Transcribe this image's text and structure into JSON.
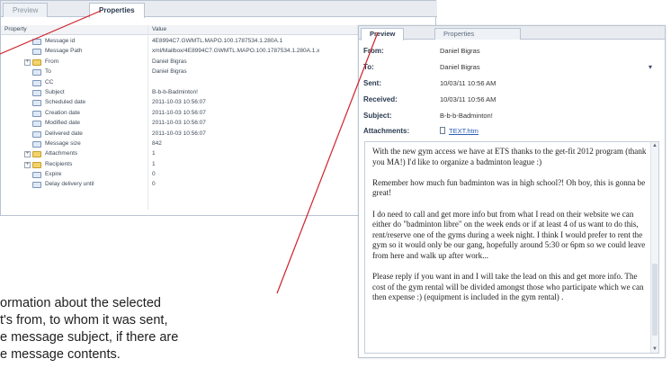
{
  "properties_panel": {
    "tabs": [
      {
        "label": "Preview",
        "active": false
      },
      {
        "label": "Properties",
        "active": true
      }
    ],
    "column_headers": {
      "property": "Property",
      "value": "Value"
    },
    "rows": [
      {
        "name": "Message id",
        "value": "4E8994C7.GWMTL.MAPO.100.1787534.1.280A.1",
        "type": "item",
        "expandable": false
      },
      {
        "name": "Message Path",
        "value": "xml/Mailbox/4E8994C7.GWMTL.MAPO.100.1787534.1.280A.1.x",
        "type": "item",
        "expandable": false
      },
      {
        "name": "From",
        "value": "Daniel Bigras",
        "type": "folder",
        "expandable": true
      },
      {
        "name": "To",
        "value": "Daniel Bigras",
        "type": "item",
        "expandable": false
      },
      {
        "name": "CC",
        "value": "",
        "type": "item",
        "expandable": false
      },
      {
        "name": "Subject",
        "value": "B-b-b-Badminton!",
        "type": "item",
        "expandable": false
      },
      {
        "name": "Scheduled date",
        "value": "2011-10-03 10:56:07",
        "type": "item",
        "expandable": false
      },
      {
        "name": "Creation date",
        "value": "2011-10-03 10:56:07",
        "type": "item",
        "expandable": false
      },
      {
        "name": "Modified date",
        "value": "2011-10-03 10:56:07",
        "type": "item",
        "expandable": false
      },
      {
        "name": "Delivered date",
        "value": "2011-10-03 10:56:07",
        "type": "item",
        "expandable": false
      },
      {
        "name": "Message size",
        "value": "842",
        "type": "item",
        "expandable": false
      },
      {
        "name": "Attachments",
        "value": "1",
        "type": "folder",
        "expandable": true
      },
      {
        "name": "Recipients",
        "value": "1",
        "type": "folder",
        "expandable": true
      },
      {
        "name": "Expire",
        "value": "0",
        "type": "item",
        "expandable": false
      },
      {
        "name": "Delay delivery until",
        "value": "0",
        "type": "item",
        "expandable": false
      }
    ]
  },
  "callout": {
    "lines": [
      "ormation about the selected",
      "t's from, to whom it was sent,",
      "e message subject, if there are",
      "e message contents."
    ],
    "line_color": "#d0202a"
  },
  "preview_panel": {
    "tabs": [
      {
        "label": "Preview",
        "active": true
      },
      {
        "label": "Properties",
        "active": false
      }
    ],
    "fields": [
      {
        "label": "From:",
        "value": "Daniel Bigras"
      },
      {
        "label": "To:",
        "value": "Daniel Bigras"
      },
      {
        "label": "Sent:",
        "value": "10/03/11 10:56 AM"
      },
      {
        "label": "Received:",
        "value": "10/03/11 10:56 AM"
      },
      {
        "label": "Subject:",
        "value": "B-b-b-Badminton!"
      }
    ],
    "attachments_label": "Attachments:",
    "attachment_file": "TEXT.htm",
    "body_paragraphs": [
      "With the new gym access we have at ETS thanks to the get-fit 2012 program (thank you MA!) I'd like to organize a badminton league :)",
      "Remember how much fun badminton was in high school?! Oh boy, this is gonna be great!",
      "I do need to call and get more info but from what I read on their website we can either do \"badminton libre\" on the week ends or if at least 4 of us want to do this, rent/reserve one of the gyms during a week night.  I think I would prefer to rent the gym so it would only be our gang, hopefully around 5:30 or 6pm so we could leave from here and walk up after work...",
      "Please reply if you want in and I will take the lead on this and get more info.  The cost of the gym rental will be divided amongst those who participate which we can then expense :) (equipment is included in the gym rental) ."
    ]
  }
}
